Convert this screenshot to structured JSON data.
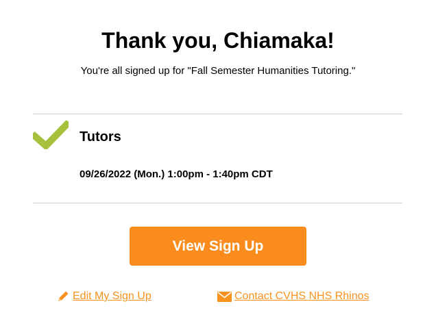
{
  "header": {
    "title": "Thank you, Chiamaka!",
    "subtitle": "You're all signed up for \"Fall Semester Humanities Tutoring.\""
  },
  "slot": {
    "status_icon": "check-icon",
    "title": "Tutors",
    "datetime": "09/26/2022 (Mon.) 1:00pm - 1:40pm CDT"
  },
  "actions": {
    "view_label": "View Sign Up",
    "edit_label": "Edit My Sign Up",
    "edit_icon": "pencil-icon",
    "contact_label": "Contact CVHS NHS Rhinos",
    "contact_icon": "envelope-icon"
  },
  "colors": {
    "accent": "#fa8c1e",
    "link": "#f7931e",
    "check": "#a6c13b",
    "divider": "#cfcfcf"
  }
}
